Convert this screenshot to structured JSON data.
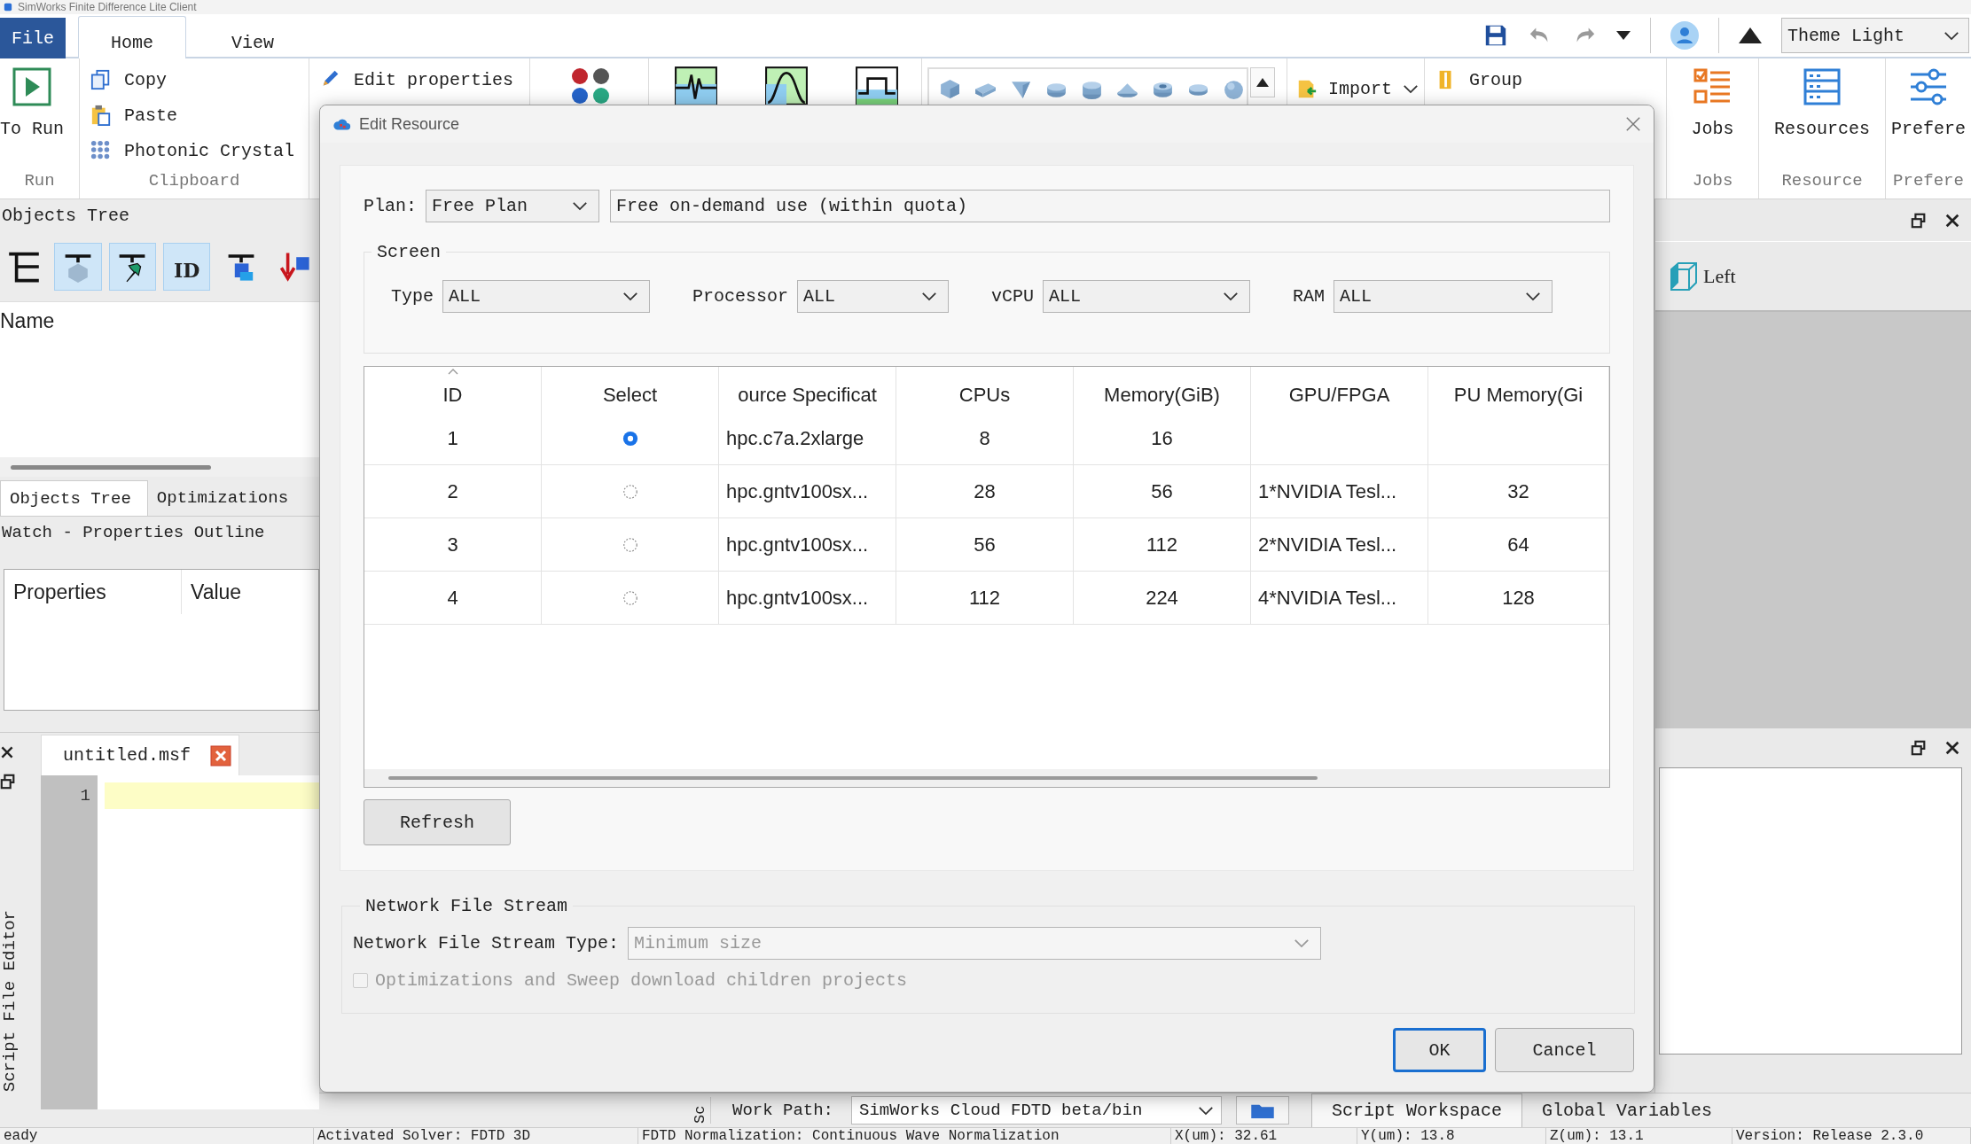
{
  "window": {
    "title": "SimWorks Finite Difference Lite Client"
  },
  "menu_tabs": [
    {
      "label": "File",
      "kind": "file",
      "selected": false
    },
    {
      "label": "Home",
      "kind": "tab",
      "selected": true
    },
    {
      "label": "View",
      "kind": "tab",
      "selected": false
    }
  ],
  "quick_access": {
    "theme": "Theme Light"
  },
  "ribbon": [
    {
      "kind": "large",
      "caption": "Run",
      "items": [
        "To Run"
      ]
    },
    {
      "kind": "small",
      "caption": "Clipboard",
      "items": [
        "Copy",
        "Paste",
        "Photonic Crystal"
      ]
    },
    {
      "kind": "small",
      "items": [
        "Edit properties"
      ]
    },
    {
      "kind": "dots"
    },
    {
      "kind": "charts"
    },
    {
      "kind": "shapes"
    },
    {
      "kind": "dropdown",
      "items": [
        "Import"
      ]
    },
    {
      "kind": "small",
      "items": [
        "Group"
      ]
    },
    {
      "kind": "large",
      "caption": "Jobs",
      "items": [
        "Jobs"
      ]
    },
    {
      "kind": "large",
      "caption": "Resource",
      "items": [
        "Resources"
      ]
    },
    {
      "kind": "large",
      "caption": "Prefere",
      "items": [
        "Prefere"
      ]
    }
  ],
  "objects_panel": {
    "title": "Objects Tree",
    "toolbar": [
      {
        "on": false
      },
      {
        "on": true
      },
      {
        "on": true
      },
      {
        "on": true,
        "label": "ID"
      },
      {
        "on": false
      },
      {
        "on": false
      }
    ],
    "columns": [
      "Name"
    ]
  },
  "panel_tabs": [
    {
      "label": "Objects Tree",
      "selected": true
    },
    {
      "label": "Optimizations",
      "selected": false
    }
  ],
  "watch": {
    "title": "Watch - Properties Outline",
    "columns": [
      "Properties",
      "Value"
    ]
  },
  "editor": {
    "side_title": "Script File Editor",
    "tabs": [
      {
        "label": "untitled.msf",
        "selected": true
      }
    ],
    "lines": [
      {
        "number": "1",
        "current": true
      }
    ]
  },
  "view_panel": {
    "view_button": "Left"
  },
  "workspace": {
    "side_title": "Sc",
    "path_label": "Work Path:",
    "path": "SimWorks Cloud FDTD beta/bin",
    "tabs": [
      {
        "label": "Script Workspace",
        "selected": true
      },
      {
        "label": "Global Variables",
        "selected": false
      }
    ]
  },
  "status_bar": [
    "eady",
    "Activated Solver: FDTD 3D",
    "FDTD Normalization: Continuous Wave Normalization",
    "X(um): 32.61",
    "Y(um): 13.8",
    "Z(um): 13.1",
    "Version: Release 2.3.0"
  ],
  "dialog": {
    "title": "Edit Resource",
    "plan": {
      "label": "Plan:",
      "value": "Free Plan",
      "description": "Free on-demand use (within quota)"
    },
    "screen": {
      "title": "Screen",
      "filters": [
        {
          "label": "Type",
          "value": "ALL"
        },
        {
          "label": "Processor",
          "value": "ALL"
        },
        {
          "label": "vCPU",
          "value": "ALL"
        },
        {
          "label": "RAM",
          "value": "ALL"
        }
      ]
    },
    "table": {
      "columns": [
        "ID",
        "Select",
        "ource Specificat",
        "CPUs",
        "Memory(GiB)",
        "GPU/FPGA",
        "PU Memory(Gi"
      ],
      "rows": [
        {
          "id": "1",
          "selected": true,
          "spec": "hpc.c7a.2xlarge",
          "cpus": "8",
          "memory": "16"
        },
        {
          "id": "2",
          "selected": false,
          "spec": "hpc.gntv100sx...",
          "cpus": "28",
          "memory": "56",
          "gpu": "1*NVIDIA Tesl...",
          "gpu_memory": "32"
        },
        {
          "id": "3",
          "selected": false,
          "spec": "hpc.gntv100sx...",
          "cpus": "56",
          "memory": "112",
          "gpu": "2*NVIDIA Tesl...",
          "gpu_memory": "64"
        },
        {
          "id": "4",
          "selected": false,
          "spec": "hpc.gntv100sx...",
          "cpus": "112",
          "memory": "224",
          "gpu": "4*NVIDIA Tesl...",
          "gpu_memory": "128"
        }
      ]
    },
    "refresh": "Refresh",
    "network": {
      "title": "Network File Stream",
      "type_label": "Network File Stream Type:",
      "type_value": "Minimum size",
      "type_disabled": true,
      "option": {
        "label": "Optimizations and Sweep download children projects",
        "checked": false,
        "disabled": true
      }
    },
    "buttons": [
      {
        "label": "OK",
        "default": true
      },
      {
        "label": "Cancel",
        "default": false
      }
    ]
  }
}
